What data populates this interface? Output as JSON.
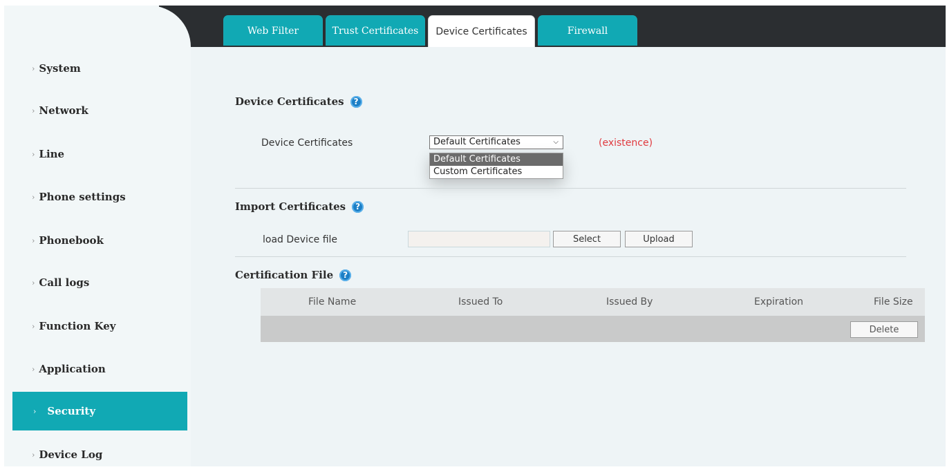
{
  "tabs": [
    {
      "label": "Web Filter",
      "active": false
    },
    {
      "label": "Trust Certificates",
      "active": false
    },
    {
      "label": "Device Certificates",
      "active": true
    },
    {
      "label": "Firewall",
      "active": false
    }
  ],
  "sidebar": {
    "items": [
      {
        "label": "System"
      },
      {
        "label": "Network"
      },
      {
        "label": "Line"
      },
      {
        "label": "Phone settings"
      },
      {
        "label": "Phonebook"
      },
      {
        "label": "Call logs"
      },
      {
        "label": "Function Key"
      },
      {
        "label": "Application"
      },
      {
        "label": "Security",
        "active": true
      },
      {
        "label": "Device Log"
      }
    ]
  },
  "device_certificates": {
    "title": "Device Certificates",
    "field_label": "Device Certificates",
    "selected": "Default Certificates",
    "status": "(existence)",
    "options": [
      "Default Certificates",
      "Custom Certificates"
    ]
  },
  "import_certificates": {
    "title": "Import Certificates",
    "field_label": "load Device file",
    "file_value": "",
    "select_button": "Select",
    "upload_button": "Upload"
  },
  "certification_file": {
    "title": "Certification File",
    "columns": [
      "File Name",
      "Issued To",
      "Issued By",
      "Expiration",
      "File Size"
    ],
    "delete_button": "Delete"
  },
  "colors": {
    "accent": "#11a9b4",
    "topbar": "#2b2e31",
    "status_red": "#e0393e",
    "help_icon": "#1c7fc6"
  },
  "icons": {
    "help": "question-circle-icon",
    "chevron": "chevron-down-icon",
    "sidebar_arrow": "chevron-right-icon"
  }
}
